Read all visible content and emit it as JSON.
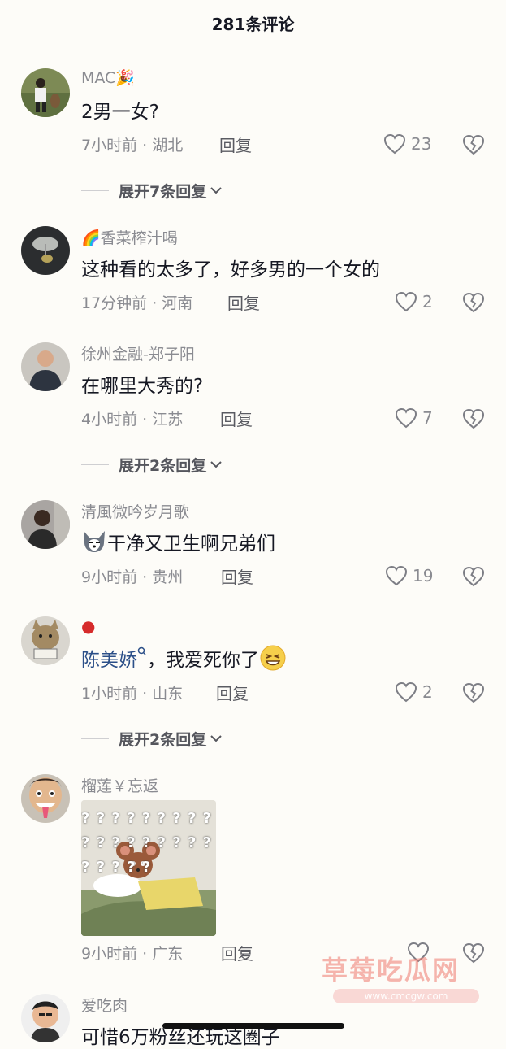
{
  "header": {
    "title": "281条评论"
  },
  "comments": [
    {
      "user": "MAC",
      "text": "2男一女?",
      "time": "7小时前 · 湖北",
      "reply": "回复",
      "likes": "23",
      "expand": "展开7条回复"
    },
    {
      "user": "香菜榨汁喝",
      "text": "这种看的太多了，好多男的一个女的",
      "time": "17分钟前 · 河南",
      "reply": "回复",
      "likes": "2"
    },
    {
      "user": "徐州金融-郑子阳",
      "text": "在哪里大秀的?",
      "time": "4小时前 · 江苏",
      "reply": "回复",
      "likes": "7",
      "expand": "展开2条回复"
    },
    {
      "user": "清風微吟岁月歌",
      "text": "干净又卫生啊兄弟们",
      "time": "9小时前 · 贵州",
      "reply": "回复",
      "likes": "19"
    },
    {
      "user": "",
      "mention": "陈美娇",
      "text": "，我爱死你了",
      "time": "1小时前 · 山东",
      "reply": "回复",
      "likes": "2",
      "expand": "展开2条回复"
    },
    {
      "user": "榴莲￥忘返",
      "image_text": "? ? ? ? ? ? ? ? ? ? ? ? ? ? ? ? ? ? ? ? ? ? ?",
      "time": "9小时前 · 广东",
      "reply": "回复"
    },
    {
      "user": "爱吃肉",
      "text": "可惜6万粉丝还玩这圈子"
    }
  ],
  "watermark": {
    "title": "草莓吃瓜网",
    "url": "www.cmcgw.com"
  },
  "colors": {
    "meta": "#8a8b91",
    "text": "#161823",
    "mention": "#2b4f88",
    "background": "#fdfcf8"
  },
  "icons": {
    "like": "heart-outline-icon",
    "dislike": "broken-heart-icon",
    "expand": "chevron-down-icon"
  }
}
